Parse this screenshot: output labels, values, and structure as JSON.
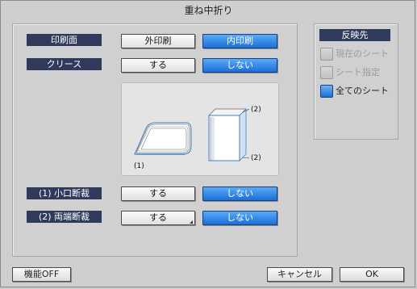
{
  "dialog": {
    "title": "重ね中折り"
  },
  "rows": [
    {
      "label": "印刷面",
      "options": [
        "外印刷",
        "内印刷"
      ],
      "selected": 1
    },
    {
      "label": "クリース",
      "options": [
        "する",
        "しない"
      ],
      "selected": 1
    },
    {
      "label": "(1) 小口断裁",
      "options": [
        "する",
        "しない"
      ],
      "selected": 1
    },
    {
      "label": "(2) 両端断裁",
      "options": [
        "する",
        "しない"
      ],
      "selected": 1
    }
  ],
  "illustration": {
    "label1": "(1)",
    "label2a": "(2)",
    "label2b": "(2)"
  },
  "apply": {
    "title": "反映先",
    "options": [
      {
        "label": "現在のシート",
        "enabled": false,
        "checked": false
      },
      {
        "label": "シート指定",
        "enabled": false,
        "checked": false
      },
      {
        "label": "全てのシート",
        "enabled": true,
        "checked": true
      }
    ]
  },
  "footer": {
    "off_label": "機能OFF",
    "cancel_label": "キャンセル",
    "ok_label": "OK"
  },
  "colors": {
    "label_bg": "#2f3a5c",
    "selected": "#2a80e8"
  }
}
